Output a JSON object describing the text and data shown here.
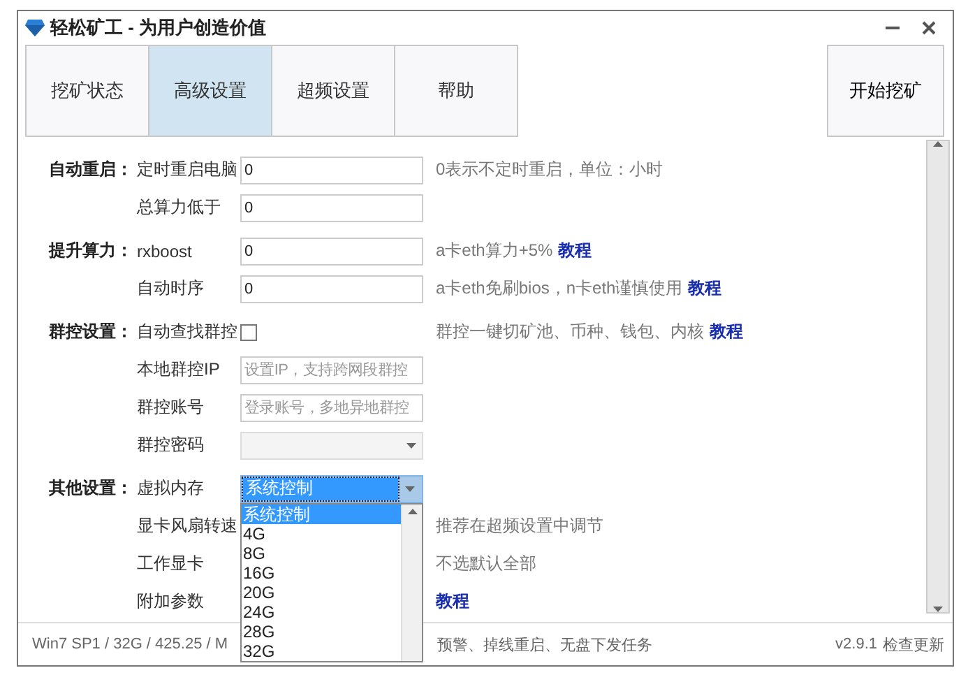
{
  "window": {
    "title": "轻松矿工 - 为用户创造价值"
  },
  "tabs": [
    {
      "label": "挖矿状态",
      "selected": false
    },
    {
      "label": "高级设置",
      "selected": true
    },
    {
      "label": "超频设置",
      "selected": false
    },
    {
      "label": "帮助",
      "selected": false
    }
  ],
  "start_button": "开始挖矿",
  "sections": [
    {
      "label": "自动重启：",
      "rows": [
        {
          "label": "定时重启电脑",
          "kind": "input",
          "value": "0",
          "hint": "0表示不定时重启，单位：小时"
        },
        {
          "label": "总算力低于",
          "kind": "input",
          "value": "0"
        }
      ]
    },
    {
      "label": "提升算力：",
      "rows": [
        {
          "label": "rxboost",
          "kind": "input",
          "value": "0",
          "hint": "a卡eth算力+5%",
          "link": "教程"
        },
        {
          "label": "自动时序",
          "kind": "input",
          "value": "0",
          "hint": "a卡eth免刷bios，n卡eth谨慎使用",
          "link": "教程"
        }
      ]
    },
    {
      "label": "群控设置：",
      "rows": [
        {
          "label": "自动查找群控",
          "kind": "checkbox",
          "checked": false,
          "hint": "群控一键切矿池、币种、钱包、内核",
          "link": "教程"
        },
        {
          "label": "本地群控IP",
          "kind": "input",
          "placeholder": "设置IP，支持跨网段群控"
        },
        {
          "label": "群控账号",
          "kind": "input",
          "placeholder": "登录账号，多地异地群控"
        },
        {
          "label": "群控密码",
          "kind": "combo"
        }
      ]
    },
    {
      "label": "其他设置：",
      "rows": [
        {
          "label": "虚拟内存",
          "kind": "dropdown",
          "value": "系统控制",
          "open": true,
          "options": [
            {
              "label": "系统控制",
              "selected": true
            },
            {
              "label": "4G",
              "selected": false
            },
            {
              "label": "8G",
              "selected": false
            },
            {
              "label": "16G",
              "selected": false
            },
            {
              "label": "20G",
              "selected": false
            },
            {
              "label": "24G",
              "selected": false
            },
            {
              "label": "28G",
              "selected": false
            },
            {
              "label": "32G",
              "selected": false
            }
          ]
        },
        {
          "label": "显卡风扇转速",
          "kind": "covered",
          "hint": "推荐在超频设置中调节"
        },
        {
          "label": "工作显卡",
          "kind": "covered",
          "hint": "不选默认全部"
        },
        {
          "label": "附加参数",
          "kind": "covered",
          "link": "教程"
        }
      ]
    }
  ],
  "status_bar": {
    "left_text": "Win7 SP1 / 32G / 425.25 / M",
    "middle_text": "预警、掉线重启、无盘下发任务",
    "version": "v2.9.1",
    "update_link": "检查更新"
  }
}
